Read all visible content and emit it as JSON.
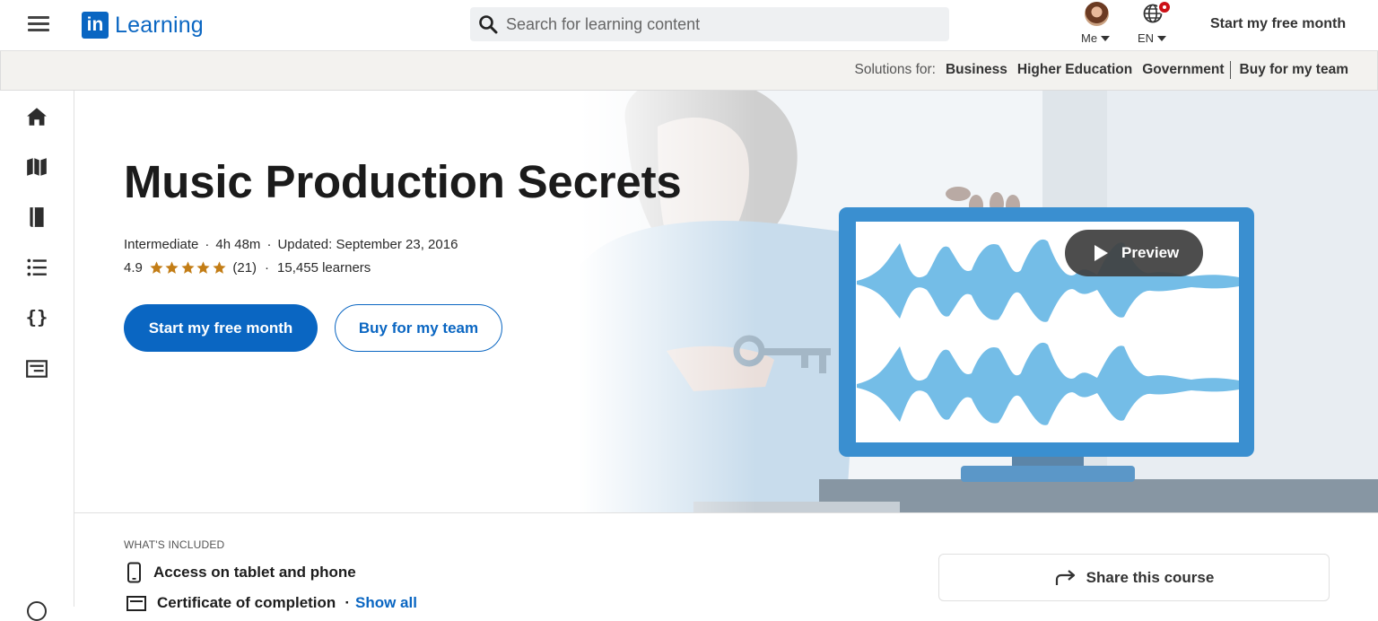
{
  "header": {
    "brand": "in",
    "product": "Learning",
    "search": {
      "placeholder": "Search for learning content",
      "value": ""
    },
    "me_label": "Me",
    "language_label": "EN",
    "cta": "Start my free month"
  },
  "solutions_bar": {
    "label": "Solutions for:",
    "links": [
      "Business",
      "Higher Education",
      "Government",
      "Buy for my team"
    ]
  },
  "rail": {
    "icons": [
      "home-icon",
      "map-icon",
      "book-icon",
      "list-icon",
      "code-icon",
      "certificate-icon"
    ]
  },
  "hero": {
    "title": "Music Production Secrets",
    "level": "Intermediate",
    "duration": "4h 48m",
    "updated": "Updated: September 23, 2016",
    "rating": "4.9",
    "rating_value": 4.9,
    "rating_max": 5,
    "reviews": "(21)",
    "learners": "15,455 learners",
    "primary_button": "Start my free month",
    "secondary_button": "Buy for my team",
    "preview_button": "Preview",
    "colors": {
      "accent": "#0a66c2",
      "star": "#c37d16"
    }
  },
  "included": {
    "heading": "WHAT'S INCLUDED",
    "items": [
      "Access on tablet and phone",
      "Certificate of completion"
    ],
    "show_all": "Show all"
  },
  "share": {
    "label": "Share this course"
  }
}
